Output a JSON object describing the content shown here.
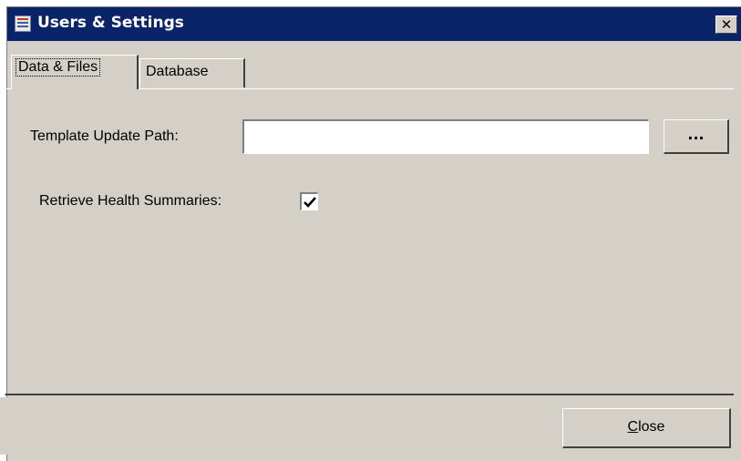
{
  "window": {
    "title": "Users & Settings",
    "title_icon": "settings-window-icon",
    "close_glyph": "✕"
  },
  "tabs": [
    {
      "label": "Data & Files",
      "active": true
    },
    {
      "label": "Database",
      "active": false
    }
  ],
  "form": {
    "template_path_label": "Template Update Path:",
    "template_path_value": "",
    "browse_label": "...",
    "health_summaries_label": "Retrieve Health Summaries:",
    "health_summaries_checked": true
  },
  "footer": {
    "close_mnemonic": "C",
    "close_rest": "lose"
  }
}
